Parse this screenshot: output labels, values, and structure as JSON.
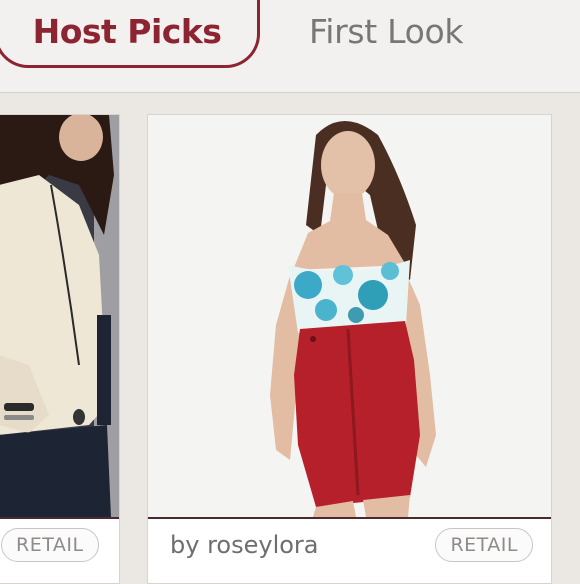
{
  "tabs": {
    "host_picks": "Host Picks",
    "first_look": "First Look"
  },
  "listings": [
    {
      "badge": "RETAIL"
    },
    {
      "seller": "by roseylora",
      "badge": "RETAIL"
    }
  ],
  "colors": {
    "accent": "#8c2431",
    "background": "#ebe7e2"
  }
}
